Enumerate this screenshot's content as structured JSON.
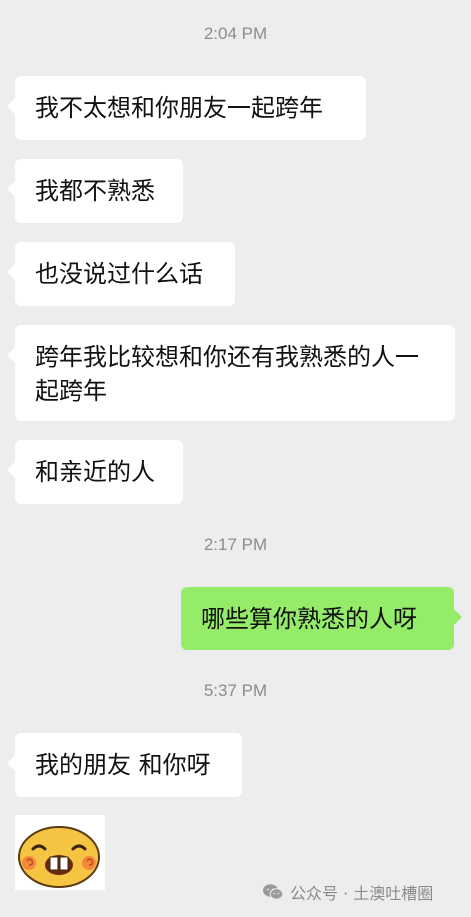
{
  "timestamps": [
    "2:04 PM",
    "2:17 PM",
    "5:37 PM"
  ],
  "messages": [
    {
      "side": "left",
      "text": "我不太想和你朋友一起跨年"
    },
    {
      "side": "left",
      "text": "我都不熟悉"
    },
    {
      "side": "left",
      "text": "也没说过什么话"
    },
    {
      "side": "left",
      "text": "跨年我比较想和你还有我熟悉的人一起跨年"
    },
    {
      "side": "left",
      "text": "和亲近的人"
    },
    {
      "side": "right",
      "text": "哪些算你熟悉的人呀"
    },
    {
      "side": "left",
      "text": "我的朋友 和你呀"
    }
  ],
  "sticker": {
    "icon": "laughing-bean-emoji-icon"
  },
  "watermark": {
    "text": "公众号 · 土澳吐槽圈",
    "icon": "wechat-icon"
  },
  "colors": {
    "background": "#ededed",
    "incoming_bubble": "#ffffff",
    "outgoing_bubble": "#95ec69",
    "timestamp": "#8c8c8c"
  }
}
